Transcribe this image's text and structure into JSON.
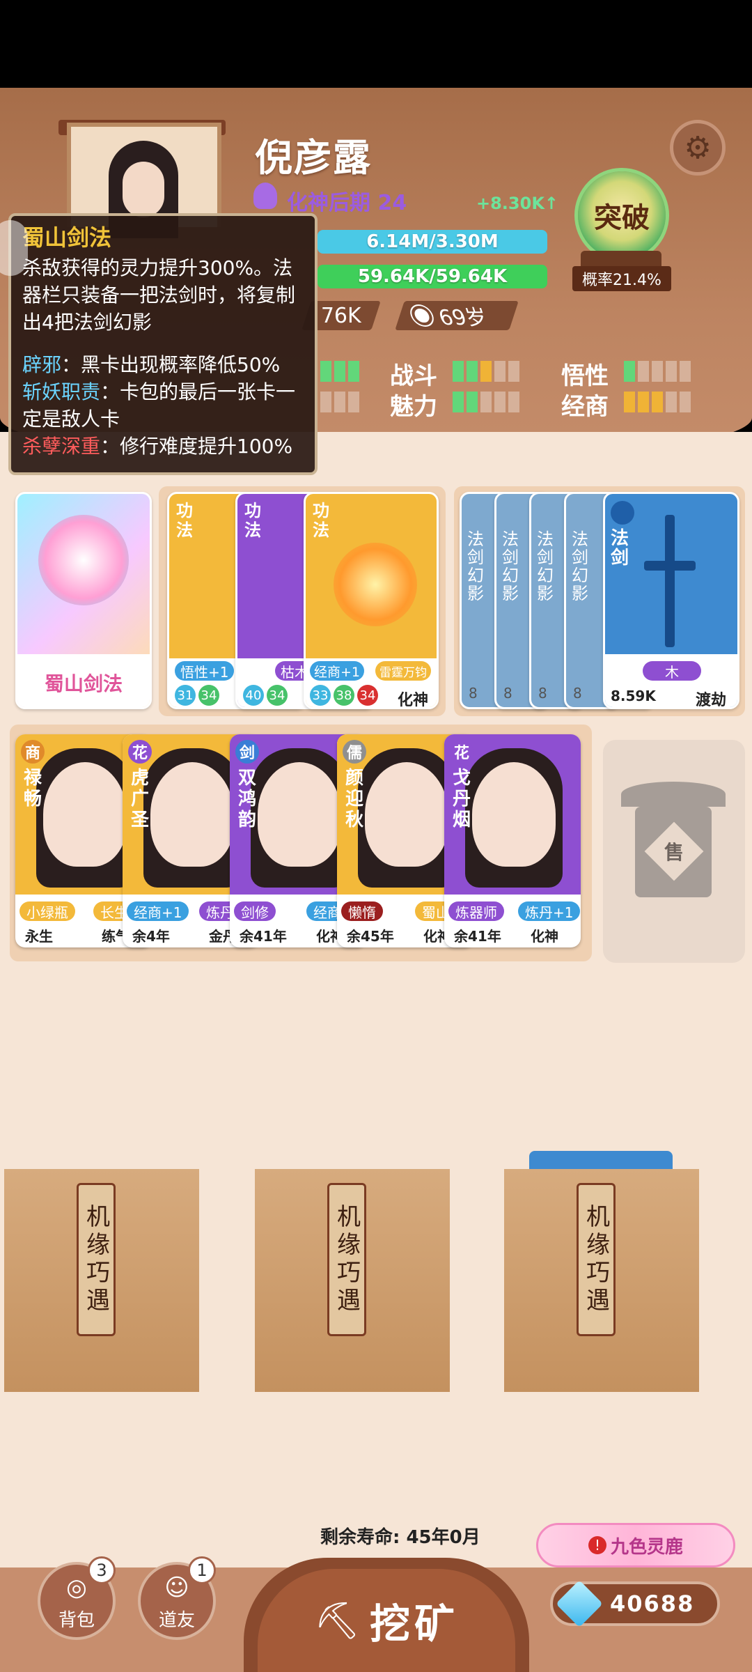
{
  "player": {
    "name": "倪彦露",
    "realm": "化神后期 24",
    "gain": "+8.30K↑",
    "hp": "6.14M/3.30M",
    "mp": "59.64K/59.64K",
    "power": "76K",
    "age": "69岁"
  },
  "breakthrough": {
    "label": "突破",
    "probability": "概率21.4%"
  },
  "stats": [
    {
      "label": "战斗",
      "filled": 3,
      "colors": [
        "g",
        "g",
        "y",
        "e",
        "e"
      ]
    },
    {
      "label": "悟性",
      "filled": 1,
      "colors": [
        "g",
        "e",
        "e",
        "e",
        "e"
      ]
    },
    {
      "label": "魅力",
      "filled": 2,
      "colors": [
        "g",
        "g",
        "e",
        "e",
        "e"
      ]
    },
    {
      "label": "经商",
      "filled": 3,
      "colors": [
        "y",
        "y",
        "y",
        "e",
        "e"
      ]
    }
  ],
  "tooltip": {
    "title": "蜀山剑法",
    "desc": "杀敌获得的灵力提升300%。法器栏只装备一把法剑时，将复制出4把法剑幻影",
    "effects": [
      {
        "name": "辟邪",
        "text": "：黑卡出现概率降低50%",
        "color": "g"
      },
      {
        "name": "斩妖职责",
        "text": "：卡包的最后一张卡一定是敌人卡",
        "color": "g"
      },
      {
        "name": "杀孽深重",
        "text": "：修行难度提升100%",
        "color": "r"
      }
    ]
  },
  "skill_card": {
    "name": "蜀山剑法"
  },
  "technique_cards": [
    {
      "type": "功法",
      "tag": "悟性+1",
      "nums": [
        "31",
        "34"
      ]
    },
    {
      "type": "功法",
      "tag": "枯木",
      "nums": [
        "40",
        "34"
      ]
    },
    {
      "type": "功法",
      "tag": "经商+1",
      "tag2": "雷霆万钧",
      "nums": [
        "33",
        "38",
        "34"
      ],
      "realm": "化神"
    }
  ],
  "sword_cards": {
    "phantom": "法剑幻影",
    "main": "法剑",
    "element": "木",
    "power": "8.59K",
    "stage": "渡劫",
    "phantom_count": "8"
  },
  "characters": [
    {
      "badge": "商",
      "name": "禄畅",
      "tag1": "小绿瓶",
      "tag2": "长生",
      "foot1": "永生",
      "foot2": "练气"
    },
    {
      "badge": "花",
      "name": "虎广圣",
      "tag1": "经商+1",
      "tag2": "炼丹",
      "foot1": "余4年",
      "foot2": "金丹"
    },
    {
      "badge": "剑",
      "name": "双鸿韵",
      "tag1": "剑修",
      "tag2": "经商",
      "foot1": "余41年",
      "foot2": "化神"
    },
    {
      "badge": "儒",
      "name": "颜迎秋",
      "tag1": "懒惰",
      "tag2": "蜀山",
      "foot1": "余45年",
      "foot2": "化神"
    },
    {
      "badge": "花",
      "name": "戈丹烟",
      "tag1": "炼器师",
      "tag2": "炼丹+1",
      "foot1": "余41年",
      "foot2": "化神"
    }
  ],
  "sell": {
    "label": "售"
  },
  "bags": [
    {
      "label": "机缘巧遇"
    },
    {
      "label": "机缘巧遇"
    },
    {
      "label": "机缘巧遇"
    }
  ],
  "footer": {
    "lifespan": "剩余寿命: 45年0月",
    "bag_label": "背包",
    "bag_count": "3",
    "friend_label": "道友",
    "friend_count": "1",
    "mine_label": "挖矿",
    "event_label": "九色灵鹿",
    "gems": "40688"
  }
}
